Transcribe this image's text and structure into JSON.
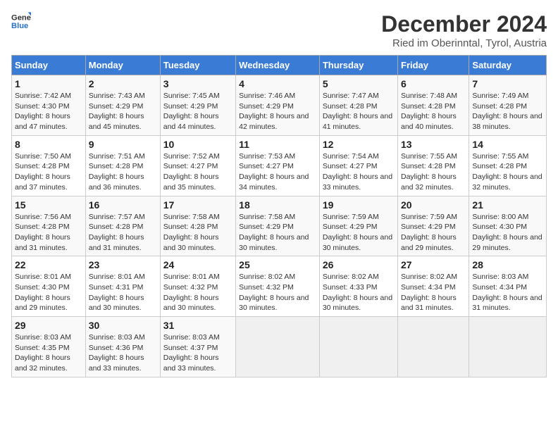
{
  "logo": {
    "general": "General",
    "blue": "Blue"
  },
  "title": "December 2024",
  "subtitle": "Ried im Oberinntal, Tyrol, Austria",
  "headers": [
    "Sunday",
    "Monday",
    "Tuesday",
    "Wednesday",
    "Thursday",
    "Friday",
    "Saturday"
  ],
  "weeks": [
    [
      {
        "day": "1",
        "sunrise": "Sunrise: 7:42 AM",
        "sunset": "Sunset: 4:30 PM",
        "daylight": "Daylight: 8 hours and 47 minutes."
      },
      {
        "day": "2",
        "sunrise": "Sunrise: 7:43 AM",
        "sunset": "Sunset: 4:29 PM",
        "daylight": "Daylight: 8 hours and 45 minutes."
      },
      {
        "day": "3",
        "sunrise": "Sunrise: 7:45 AM",
        "sunset": "Sunset: 4:29 PM",
        "daylight": "Daylight: 8 hours and 44 minutes."
      },
      {
        "day": "4",
        "sunrise": "Sunrise: 7:46 AM",
        "sunset": "Sunset: 4:29 PM",
        "daylight": "Daylight: 8 hours and 42 minutes."
      },
      {
        "day": "5",
        "sunrise": "Sunrise: 7:47 AM",
        "sunset": "Sunset: 4:28 PM",
        "daylight": "Daylight: 8 hours and 41 minutes."
      },
      {
        "day": "6",
        "sunrise": "Sunrise: 7:48 AM",
        "sunset": "Sunset: 4:28 PM",
        "daylight": "Daylight: 8 hours and 40 minutes."
      },
      {
        "day": "7",
        "sunrise": "Sunrise: 7:49 AM",
        "sunset": "Sunset: 4:28 PM",
        "daylight": "Daylight: 8 hours and 38 minutes."
      }
    ],
    [
      {
        "day": "8",
        "sunrise": "Sunrise: 7:50 AM",
        "sunset": "Sunset: 4:28 PM",
        "daylight": "Daylight: 8 hours and 37 minutes."
      },
      {
        "day": "9",
        "sunrise": "Sunrise: 7:51 AM",
        "sunset": "Sunset: 4:28 PM",
        "daylight": "Daylight: 8 hours and 36 minutes."
      },
      {
        "day": "10",
        "sunrise": "Sunrise: 7:52 AM",
        "sunset": "Sunset: 4:27 PM",
        "daylight": "Daylight: 8 hours and 35 minutes."
      },
      {
        "day": "11",
        "sunrise": "Sunrise: 7:53 AM",
        "sunset": "Sunset: 4:27 PM",
        "daylight": "Daylight: 8 hours and 34 minutes."
      },
      {
        "day": "12",
        "sunrise": "Sunrise: 7:54 AM",
        "sunset": "Sunset: 4:27 PM",
        "daylight": "Daylight: 8 hours and 33 minutes."
      },
      {
        "day": "13",
        "sunrise": "Sunrise: 7:55 AM",
        "sunset": "Sunset: 4:28 PM",
        "daylight": "Daylight: 8 hours and 32 minutes."
      },
      {
        "day": "14",
        "sunrise": "Sunrise: 7:55 AM",
        "sunset": "Sunset: 4:28 PM",
        "daylight": "Daylight: 8 hours and 32 minutes."
      }
    ],
    [
      {
        "day": "15",
        "sunrise": "Sunrise: 7:56 AM",
        "sunset": "Sunset: 4:28 PM",
        "daylight": "Daylight: 8 hours and 31 minutes."
      },
      {
        "day": "16",
        "sunrise": "Sunrise: 7:57 AM",
        "sunset": "Sunset: 4:28 PM",
        "daylight": "Daylight: 8 hours and 31 minutes."
      },
      {
        "day": "17",
        "sunrise": "Sunrise: 7:58 AM",
        "sunset": "Sunset: 4:28 PM",
        "daylight": "Daylight: 8 hours and 30 minutes."
      },
      {
        "day": "18",
        "sunrise": "Sunrise: 7:58 AM",
        "sunset": "Sunset: 4:29 PM",
        "daylight": "Daylight: 8 hours and 30 minutes."
      },
      {
        "day": "19",
        "sunrise": "Sunrise: 7:59 AM",
        "sunset": "Sunset: 4:29 PM",
        "daylight": "Daylight: 8 hours and 30 minutes."
      },
      {
        "day": "20",
        "sunrise": "Sunrise: 7:59 AM",
        "sunset": "Sunset: 4:29 PM",
        "daylight": "Daylight: 8 hours and 29 minutes."
      },
      {
        "day": "21",
        "sunrise": "Sunrise: 8:00 AM",
        "sunset": "Sunset: 4:30 PM",
        "daylight": "Daylight: 8 hours and 29 minutes."
      }
    ],
    [
      {
        "day": "22",
        "sunrise": "Sunrise: 8:01 AM",
        "sunset": "Sunset: 4:30 PM",
        "daylight": "Daylight: 8 hours and 29 minutes."
      },
      {
        "day": "23",
        "sunrise": "Sunrise: 8:01 AM",
        "sunset": "Sunset: 4:31 PM",
        "daylight": "Daylight: 8 hours and 30 minutes."
      },
      {
        "day": "24",
        "sunrise": "Sunrise: 8:01 AM",
        "sunset": "Sunset: 4:32 PM",
        "daylight": "Daylight: 8 hours and 30 minutes."
      },
      {
        "day": "25",
        "sunrise": "Sunrise: 8:02 AM",
        "sunset": "Sunset: 4:32 PM",
        "daylight": "Daylight: 8 hours and 30 minutes."
      },
      {
        "day": "26",
        "sunrise": "Sunrise: 8:02 AM",
        "sunset": "Sunset: 4:33 PM",
        "daylight": "Daylight: 8 hours and 30 minutes."
      },
      {
        "day": "27",
        "sunrise": "Sunrise: 8:02 AM",
        "sunset": "Sunset: 4:34 PM",
        "daylight": "Daylight: 8 hours and 31 minutes."
      },
      {
        "day": "28",
        "sunrise": "Sunrise: 8:03 AM",
        "sunset": "Sunset: 4:34 PM",
        "daylight": "Daylight: 8 hours and 31 minutes."
      }
    ],
    [
      {
        "day": "29",
        "sunrise": "Sunrise: 8:03 AM",
        "sunset": "Sunset: 4:35 PM",
        "daylight": "Daylight: 8 hours and 32 minutes."
      },
      {
        "day": "30",
        "sunrise": "Sunrise: 8:03 AM",
        "sunset": "Sunset: 4:36 PM",
        "daylight": "Daylight: 8 hours and 33 minutes."
      },
      {
        "day": "31",
        "sunrise": "Sunrise: 8:03 AM",
        "sunset": "Sunset: 4:37 PM",
        "daylight": "Daylight: 8 hours and 33 minutes."
      },
      null,
      null,
      null,
      null
    ]
  ]
}
